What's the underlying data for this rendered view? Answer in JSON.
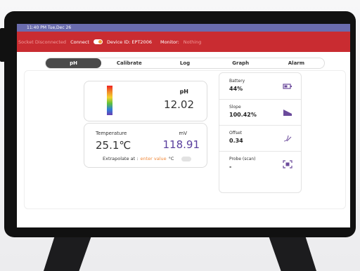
{
  "status_bar": {
    "time": "11:40 PM Tue,Dec 26"
  },
  "app_bar": {
    "socket_status": "Socket Disconnected",
    "connect_label": "Connect",
    "device_id": "Device ID: EPT2006",
    "monitor_label": "Monitor:",
    "monitor_value": "Nothing"
  },
  "tabs": [
    "pH",
    "Calibrate",
    "Log",
    "Graph",
    "Alarm"
  ],
  "active_tab": "pH",
  "ph_card": {
    "label": "pH",
    "value": "12.02"
  },
  "temperature_card": {
    "temp_label": "Temperature",
    "temp_value": "25.1℃",
    "mv_label": "mV",
    "mv_value": "118.91",
    "extrapolate_label": "Extrapolate at :",
    "extrapolate_placeholder": "enter value",
    "unit": "°C"
  },
  "info": {
    "battery": {
      "label": "Battery",
      "value": "44%",
      "icon": "battery-icon"
    },
    "slope": {
      "label": "Slope",
      "value": "100.42%",
      "icon": "slope-icon"
    },
    "offset": {
      "label": "Offset",
      "value": "0.34",
      "icon": "offset-icon"
    },
    "probe": {
      "label": "Probe (scan)",
      "value": "-",
      "icon": "scan-icon"
    }
  },
  "colors": {
    "accent": "#c92c31",
    "status_bar": "#6a6cae",
    "mv_value": "#5a3f9e",
    "placeholder": "#f08a3c"
  }
}
